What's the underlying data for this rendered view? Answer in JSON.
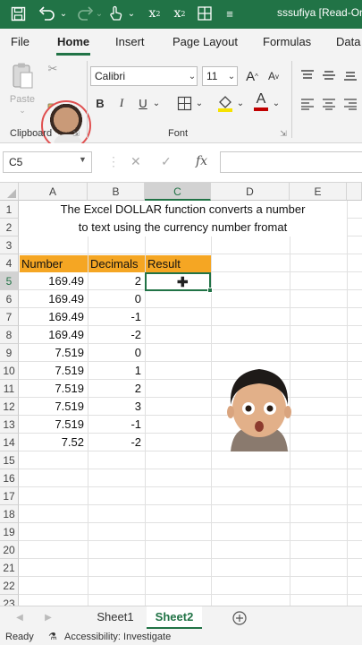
{
  "titlebar": {
    "title": "sssufiya  [Read-On",
    "icons": [
      "save-icon",
      "undo-icon",
      "redo-icon",
      "touch-mode-icon",
      "subscript-icon",
      "superscript-icon",
      "borders-icon",
      "customize-icon"
    ],
    "subscript": "x",
    "superscript": "x",
    "more": "≡"
  },
  "tabs": [
    "File",
    "Home",
    "Insert",
    "Page Layout",
    "Formulas",
    "Data"
  ],
  "ribbon": {
    "paste_label": "Paste",
    "clipboard_label": "Clipboard",
    "font_label": "Font",
    "font_name": "Calibri",
    "font_size": "11",
    "grow_label": "A",
    "shrink_label": "A",
    "bold": "B",
    "italic": "I",
    "underline": "U",
    "font_color_glyph": "A",
    "fill_color": "#f6e200",
    "font_color": "#c00000"
  },
  "formula_bar": {
    "name_box": "C5",
    "fx_label": "fx",
    "formula": ""
  },
  "sheet": {
    "columns": [
      "A",
      "B",
      "C",
      "D",
      "E"
    ],
    "rows": [
      "1",
      "2",
      "3",
      "4",
      "5",
      "6",
      "7",
      "8",
      "9",
      "10",
      "11",
      "12",
      "13",
      "14",
      "15",
      "16",
      "17",
      "18",
      "19",
      "20",
      "21",
      "22",
      "23"
    ],
    "description_line1": "The Excel DOLLAR function converts a number",
    "description_line2": "to text using the currency number fromat",
    "headers": [
      "Number",
      "Decimals",
      "Result"
    ],
    "data": [
      [
        "169.49",
        "2"
      ],
      [
        "169.49",
        "0"
      ],
      [
        "169.49",
        "-1"
      ],
      [
        "169.49",
        "-2"
      ],
      [
        "7.519",
        "0"
      ],
      [
        "7.519",
        "1"
      ],
      [
        "7.519",
        "2"
      ],
      [
        "7.519",
        "3"
      ],
      [
        "7.519",
        "-1"
      ],
      [
        "7.52",
        "-2"
      ]
    ],
    "header_fill": "#f5a623",
    "selected_cell": "C5"
  },
  "sheet_tabs": [
    "Sheet1",
    "Sheet2"
  ],
  "active_sheet": "Sheet2",
  "status": {
    "ready": "Ready",
    "accessibility": "Accessibility: Investigate"
  },
  "theme": {
    "accent": "#217346"
  }
}
